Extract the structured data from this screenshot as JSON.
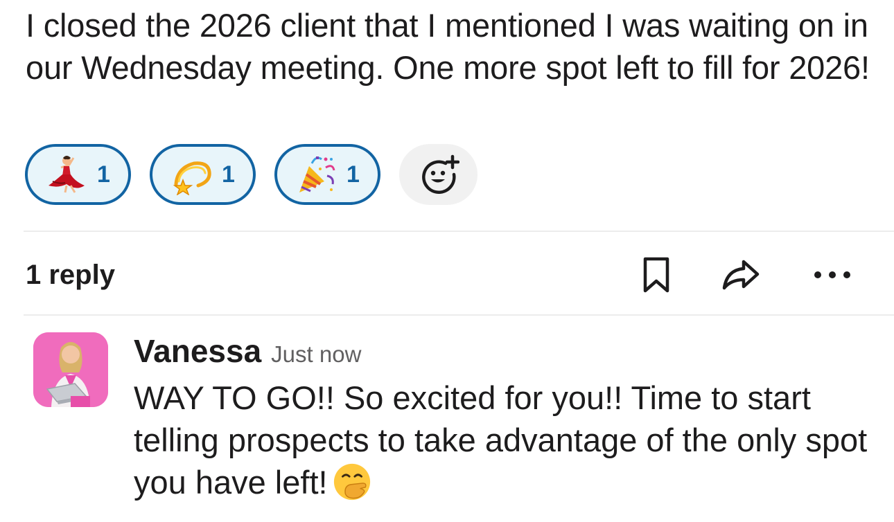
{
  "message": {
    "text": "I closed the 2026 client that I mentioned I was waiting on in our Wednesday meeting. One more spot left to fill for 2026!"
  },
  "reactions": [
    {
      "emoji": "dancer-emoji",
      "count": "1"
    },
    {
      "emoji": "dizzy-emoji",
      "count": "1"
    },
    {
      "emoji": "party-popper-emoji",
      "count": "1"
    }
  ],
  "add_reaction_icon": "add-reaction-icon",
  "thread": {
    "reply_count": "1 reply",
    "actions": [
      "bookmark-icon",
      "share-icon",
      "more-icon"
    ]
  },
  "reply": {
    "author": "Vanessa",
    "timestamp": "Just now",
    "text": "WAY TO GO!! So excited for you!! Time to start telling prospects to take advantage of the only spot you have left!",
    "emoji": "face-with-hand-over-mouth-emoji"
  },
  "colors": {
    "reaction_border": "#1264a3",
    "reaction_bg": "#e8f5fa",
    "avatar_bg": "#f06cbd"
  }
}
